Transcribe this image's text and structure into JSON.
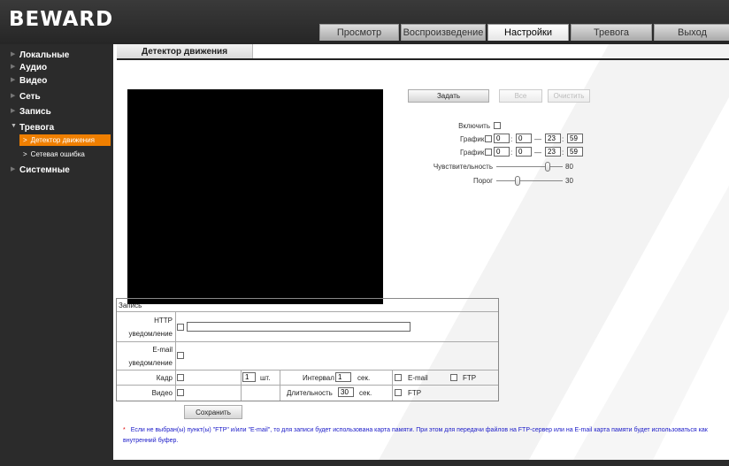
{
  "header": {
    "logo": "BEWARD",
    "tabs": [
      {
        "label": "Просмотр",
        "active": false
      },
      {
        "label": "Воспроизведение",
        "active": false
      },
      {
        "label": "Настройки",
        "active": true
      },
      {
        "label": "Тревога",
        "active": false
      },
      {
        "label": "Выход",
        "active": false
      }
    ]
  },
  "sidebar": {
    "items": [
      {
        "label": "Локальные"
      },
      {
        "label": "Аудио"
      },
      {
        "label": "Видео"
      },
      {
        "label": "Сеть"
      },
      {
        "label": "Запись"
      },
      {
        "label": "Тревога",
        "expanded": true
      },
      {
        "label": "Системные"
      }
    ],
    "subitems": [
      {
        "label": "Детектор движения",
        "active": true
      },
      {
        "label": "Сетевая ошибка",
        "active": false
      }
    ]
  },
  "page": {
    "title": "Детектор движения",
    "buttons": {
      "set": "Задать",
      "all": "Все",
      "clear": "Очистить"
    },
    "enable_label": "Включить",
    "schedule1": {
      "label": "График 1",
      "start_h": "0",
      "start_m": "0",
      "end_h": "23",
      "end_m": "59"
    },
    "schedule2": {
      "label": "График 2",
      "start_h": "0",
      "start_m": "0",
      "end_h": "23",
      "end_m": "59"
    },
    "sensitivity": {
      "label": "Чувствительность",
      "value": "80",
      "level": 80
    },
    "threshold": {
      "label": "Порог",
      "value": "30",
      "level": 30
    }
  },
  "record_table": {
    "header": "Запись",
    "http_label_1": "HTTP",
    "http_label_2": "уведомление",
    "http_value": "",
    "email_label_1": "E-mail",
    "email_label_2": "уведомление",
    "frame_label": "Кадр",
    "frame_count": "1",
    "frame_unit": "шт.",
    "interval_label": "Интервал",
    "interval_value": "1",
    "interval_unit": "сек.",
    "frame_email": "E-mail",
    "frame_ftp": "FTP",
    "video_label": "Видео",
    "duration_label": "Длительность",
    "duration_value": "30",
    "duration_unit": "сек.",
    "video_ftp": "FTP"
  },
  "save_button": "Сохранить",
  "note": {
    "star": "*",
    "text": "Если не выбран(ы) пункт(ы) \"FTP\" и/или \"E-mail\", то для записи будет использована карта памяти. При этом для передачи файлов на FTP-сервер или на E-mail карта памяти будет использоваться как внутренний буфер."
  }
}
